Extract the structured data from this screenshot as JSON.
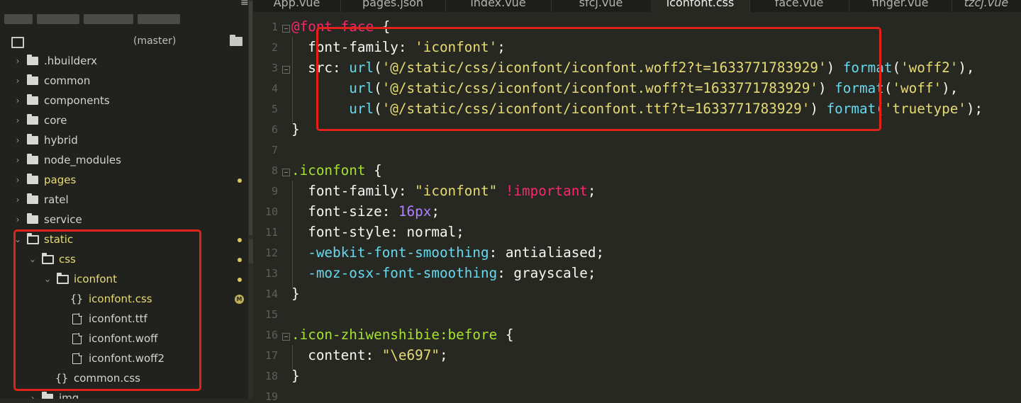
{
  "sidebar": {
    "branch": "(master)",
    "tree": [
      {
        "label": ".hbuilderx",
        "state": "closed"
      },
      {
        "label": "common",
        "state": "closed"
      },
      {
        "label": "components",
        "state": "closed"
      },
      {
        "label": "core",
        "state": "closed"
      },
      {
        "label": "hybrid",
        "state": "closed"
      },
      {
        "label": "node_modules",
        "state": "closed"
      },
      {
        "label": "pages",
        "state": "closed",
        "modified": true
      },
      {
        "label": "ratel",
        "state": "closed"
      },
      {
        "label": "service",
        "state": "closed"
      },
      {
        "label": "static",
        "state": "open",
        "modified": true
      },
      {
        "label": "css",
        "state": "open",
        "modified": true
      },
      {
        "label": "iconfont",
        "state": "open",
        "modified": true
      },
      {
        "label": "iconfont.css",
        "type": "css-file",
        "modified": true,
        "badge": "M"
      },
      {
        "label": "iconfont.ttf",
        "type": "file"
      },
      {
        "label": "iconfont.woff",
        "type": "file"
      },
      {
        "label": "iconfont.woff2",
        "type": "file"
      },
      {
        "label": "common.css",
        "type": "css-file"
      },
      {
        "label": "img",
        "state": "closed"
      }
    ]
  },
  "tabs": [
    {
      "label": "App.vue"
    },
    {
      "label": "pages.json"
    },
    {
      "label": "index.vue"
    },
    {
      "label": "sfcj.vue"
    },
    {
      "label": "iconfont.css",
      "active": true
    },
    {
      "label": "face.vue"
    },
    {
      "label": "finger.vue"
    },
    {
      "label": "tzcj.vue",
      "italic": true
    }
  ],
  "menu_icon": "menu-icon",
  "collapse_icon": "chevron-left-icon",
  "editor": {
    "line_numbers": [
      "1",
      "2",
      "3",
      "4",
      "5",
      "6",
      "7",
      "8",
      "9",
      "10",
      "11",
      "12",
      "13",
      "14",
      "15",
      "16",
      "17",
      "18",
      "19"
    ],
    "lines": [
      [
        {
          "t": "@font-face",
          "c": "kw"
        },
        {
          "t": " {",
          "c": "punct"
        }
      ],
      [
        {
          "t": "  font-family: ",
          "c": "prop"
        },
        {
          "t": "'iconfont'",
          "c": "str"
        },
        {
          "t": ";",
          "c": "punct"
        }
      ],
      [
        {
          "t": "  src: ",
          "c": "prop"
        },
        {
          "t": "url",
          "c": "fn"
        },
        {
          "t": "(",
          "c": "punct"
        },
        {
          "t": "'@/static/css/iconfont/iconfont.woff2?t=1633771783929'",
          "c": "str"
        },
        {
          "t": ") ",
          "c": "punct"
        },
        {
          "t": "format",
          "c": "fn"
        },
        {
          "t": "(",
          "c": "punct"
        },
        {
          "t": "'woff2'",
          "c": "str"
        },
        {
          "t": "),",
          "c": "punct"
        }
      ],
      [
        {
          "t": "       ",
          "c": "prop"
        },
        {
          "t": "url",
          "c": "fn"
        },
        {
          "t": "(",
          "c": "punct"
        },
        {
          "t": "'@/static/css/iconfont/iconfont.woff?t=1633771783929'",
          "c": "str"
        },
        {
          "t": ") ",
          "c": "punct"
        },
        {
          "t": "format",
          "c": "fn"
        },
        {
          "t": "(",
          "c": "punct"
        },
        {
          "t": "'woff'",
          "c": "str"
        },
        {
          "t": "),",
          "c": "punct"
        }
      ],
      [
        {
          "t": "       ",
          "c": "prop"
        },
        {
          "t": "url",
          "c": "fn"
        },
        {
          "t": "(",
          "c": "punct"
        },
        {
          "t": "'@/static/css/iconfont/iconfont.ttf?t=1633771783929'",
          "c": "str"
        },
        {
          "t": ") ",
          "c": "punct"
        },
        {
          "t": "format",
          "c": "fn"
        },
        {
          "t": "(",
          "c": "punct"
        },
        {
          "t": "'truetype'",
          "c": "str"
        },
        {
          "t": ");",
          "c": "punct"
        }
      ],
      [
        {
          "t": "}",
          "c": "punct"
        }
      ],
      [],
      [
        {
          "t": ".iconfont",
          "c": "sel"
        },
        {
          "t": " {",
          "c": "punct"
        }
      ],
      [
        {
          "t": "  font-family: ",
          "c": "prop"
        },
        {
          "t": "\"iconfont\"",
          "c": "str"
        },
        {
          "t": " ",
          "c": "punct"
        },
        {
          "t": "!important",
          "c": "imp"
        },
        {
          "t": ";",
          "c": "punct"
        }
      ],
      [
        {
          "t": "  font-size: ",
          "c": "prop"
        },
        {
          "t": "16px",
          "c": "num"
        },
        {
          "t": ";",
          "c": "punct"
        }
      ],
      [
        {
          "t": "  font-style: normal;",
          "c": "prop"
        }
      ],
      [
        {
          "t": "  ",
          "c": "prop"
        },
        {
          "t": "-webkit-font-smoothing",
          "c": "vprop"
        },
        {
          "t": ": antialiased;",
          "c": "prop"
        }
      ],
      [
        {
          "t": "  ",
          "c": "prop"
        },
        {
          "t": "-moz-osx-font-smoothing",
          "c": "vprop"
        },
        {
          "t": ": grayscale;",
          "c": "prop"
        }
      ],
      [
        {
          "t": "}",
          "c": "punct"
        }
      ],
      [],
      [
        {
          "t": ".icon-zhiwenshibie:before",
          "c": "sel"
        },
        {
          "t": " {",
          "c": "punct"
        }
      ],
      [
        {
          "t": "  content: ",
          "c": "prop"
        },
        {
          "t": "\"\\e697\"",
          "c": "str"
        },
        {
          "t": ";",
          "c": "punct"
        }
      ],
      [
        {
          "t": "}",
          "c": "punct"
        }
      ],
      []
    ]
  },
  "colors": {
    "highlight_box": "#e0231a",
    "background": "#272822",
    "sidebar": "#21221d"
  }
}
